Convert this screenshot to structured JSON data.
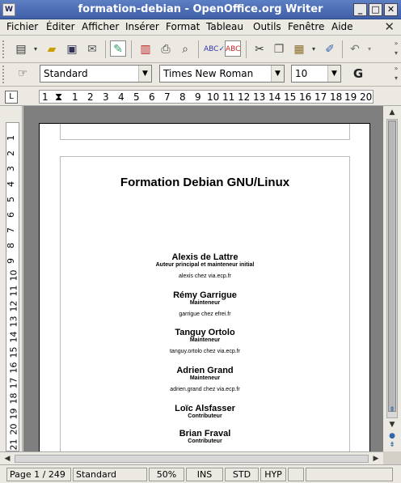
{
  "window": {
    "title": "formation-debian - OpenOffice.org Writer",
    "app_icon": "W"
  },
  "window_buttons": {
    "minimize": "_",
    "maximize": "□",
    "close": "✕"
  },
  "menu": {
    "items": [
      "Fichier",
      "Éditer",
      "Afficher",
      "Insérer",
      "Format",
      "Tableau",
      "Outils",
      "Fenêtre",
      "Aide"
    ],
    "close_glyph": "✕"
  },
  "formatting": {
    "style": "Standard",
    "font": "Times New Roman",
    "size": "10",
    "bold_label": "G"
  },
  "ruler": {
    "corner": "L",
    "ticks": [
      "1",
      "1",
      "2",
      "3",
      "4",
      "5",
      "6",
      "7",
      "8",
      "9",
      "10",
      "11",
      "12",
      "13",
      "14",
      "15",
      "16",
      "17",
      "18",
      "19",
      "20"
    ],
    "vticks": [
      "1",
      "2",
      "3",
      "4",
      "5",
      "6",
      "7",
      "8",
      "9",
      "10",
      "11",
      "12",
      "13",
      "14",
      "15",
      "16",
      "17",
      "18",
      "19",
      "20",
      "21"
    ]
  },
  "document": {
    "title": "Formation Debian GNU/Linux",
    "authors": [
      {
        "name": "Alexis de Lattre",
        "role": "Auteur principal et mainteneur initial",
        "email": "alexis chez via.ecp.fr"
      },
      {
        "name": "Rémy Garrigue",
        "role": "Mainteneur",
        "email": "garrigue chez efrei.fr"
      },
      {
        "name": "Tanguy Ortolo",
        "role": "Mainteneur",
        "email": "tanguy.ortolo chez via.ecp.fr"
      },
      {
        "name": "Adrien Grand",
        "role": "Mainteneur",
        "email": "adrien.grand chez via.ecp.fr"
      },
      {
        "name": "Loïc Alsfasser",
        "role": "Contributeur",
        "email": ""
      },
      {
        "name": "Brian Fraval",
        "role": "Contributeur",
        "email": ""
      }
    ]
  },
  "status": {
    "page": "Page 1 / 249",
    "style": "Standard",
    "zoom": "50%",
    "insert_mode": "INS",
    "selection_mode": "STD",
    "hyperlink_mode": "HYP"
  },
  "colors": {
    "titlebar": "#4a6cb4",
    "chrome": "#ece9e3",
    "doc_background": "#7f7f7f"
  }
}
